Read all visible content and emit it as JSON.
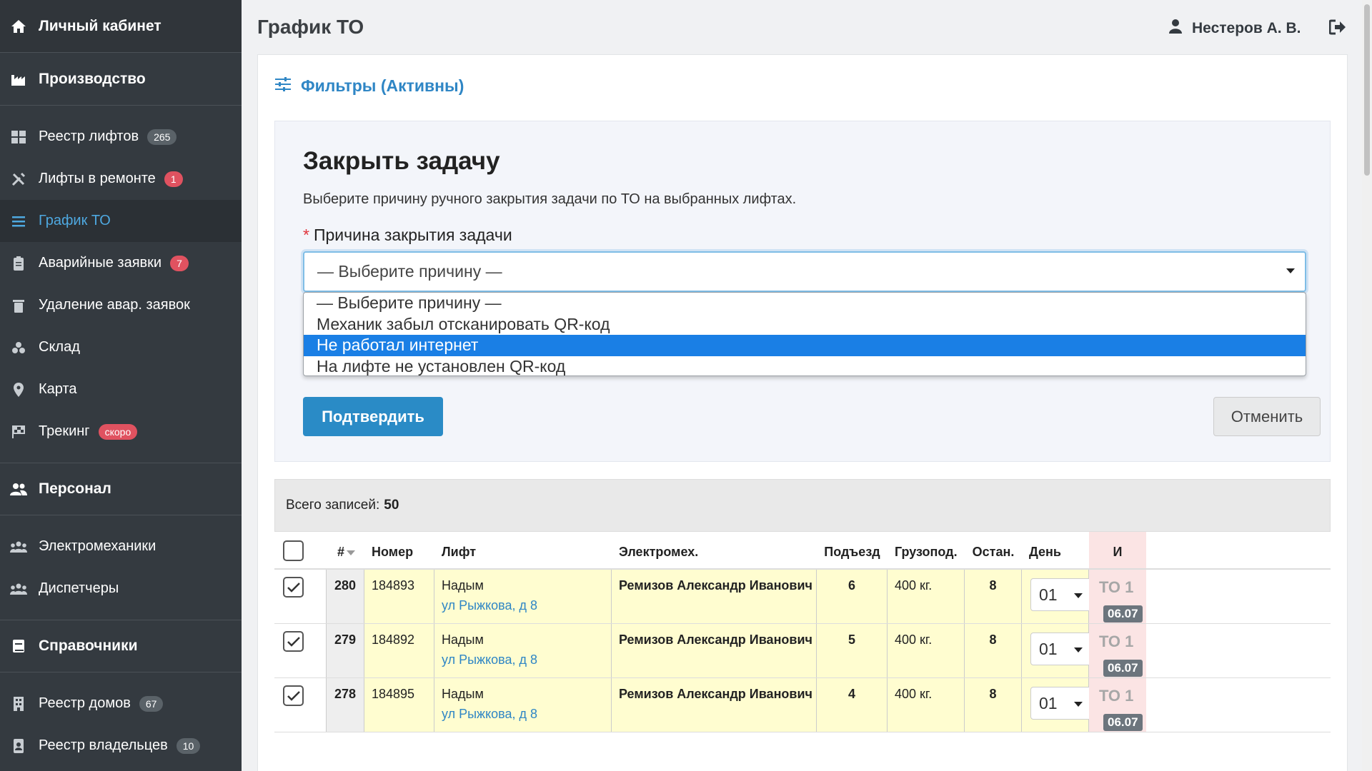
{
  "sidebar": {
    "home": "Личный кабинет",
    "production": "Производство",
    "items_production": [
      {
        "label": "Реестр лифтов",
        "badge": "265",
        "icon": "grid-icon"
      },
      {
        "label": "Лифты в ремонте",
        "badge": "1",
        "icon": "tools-icon"
      },
      {
        "label": "График ТО",
        "badge": "",
        "icon": "list-icon"
      },
      {
        "label": "Аварийные заявки",
        "badge": "7",
        "icon": "clipboard-icon"
      },
      {
        "label": "Удаление авар. заявок",
        "badge": "",
        "icon": "trash-icon"
      },
      {
        "label": "Склад",
        "badge": "",
        "icon": "boxes-icon"
      },
      {
        "label": "Карта",
        "badge": "",
        "icon": "map-pin-icon"
      },
      {
        "label": "Трекинг",
        "badge": "скоро",
        "icon": "flag-icon"
      }
    ],
    "personnel": "Персонал",
    "items_personnel": [
      {
        "label": "Электромеханики"
      },
      {
        "label": "Диспетчеры"
      }
    ],
    "reference": "Справочники",
    "items_reference": [
      {
        "label": "Реестр домов",
        "badge": "67"
      },
      {
        "label": "Реестр владельцев",
        "badge": "10"
      }
    ]
  },
  "header": {
    "title": "График ТО",
    "user": "Нестеров А. В."
  },
  "filters": {
    "label": "Фильтры (Активны)"
  },
  "modal": {
    "title": "Закрыть задачу",
    "description": "Выберите причину ручного закрытия задачи по ТО на выбранных лифтах.",
    "field_label": "Причина закрытия задачи",
    "required_mark": "*",
    "selected_value": "— Выберите причину —",
    "options": [
      "— Выберите причину —",
      "Механик забыл отсканировать QR-код",
      "Не работал интернет",
      "На лифте не установлен QR-код"
    ],
    "highlighted_option": "Не работал интернет",
    "confirm": "Подтвердить",
    "cancel": "Отменить"
  },
  "table": {
    "total_label": "Всего записей:",
    "total_value": "50",
    "headers": {
      "num": "#",
      "number": "Номер",
      "lift": "Лифт",
      "mechanic": "Электромех.",
      "entrance": "Подъезд",
      "capacity": "Грузопод.",
      "stops": "Остан.",
      "day": "День",
      "last": "И"
    },
    "rows": [
      {
        "id": "280",
        "number": "184893",
        "city": "Надым",
        "address": "ул Рыжкова, д 8",
        "mechanic": "Ремизов Александр Иванович",
        "entrance": "6",
        "capacity": "400 кг.",
        "stops": "8",
        "day": "01",
        "to": "ТО 1",
        "date": "06.07",
        "checked": true
      },
      {
        "id": "279",
        "number": "184892",
        "city": "Надым",
        "address": "ул Рыжкова, д 8",
        "mechanic": "Ремизов Александр Иванович",
        "entrance": "5",
        "capacity": "400 кг.",
        "stops": "8",
        "day": "01",
        "to": "ТО 1",
        "date": "06.07",
        "checked": true
      },
      {
        "id": "278",
        "number": "184895",
        "city": "Надым",
        "address": "ул Рыжкова, д 8",
        "mechanic": "Ремизов Александр Иванович",
        "entrance": "4",
        "capacity": "400 кг.",
        "stops": "8",
        "day": "01",
        "to": "ТО 1",
        "date": "06.07",
        "checked": true
      }
    ]
  },
  "colors": {
    "sidebar_bg": "#343a40",
    "accent": "#2f86c5",
    "option_highlight": "#1a7fe5",
    "row_bg": "#fffdd0",
    "badge_red": "#e05260"
  }
}
